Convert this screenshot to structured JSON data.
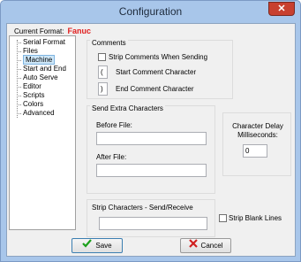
{
  "window": {
    "title": "Configuration"
  },
  "format": {
    "label": "Current Format:",
    "value": "Fanuc"
  },
  "tree": {
    "items": [
      {
        "label": "Serial Format",
        "selected": false
      },
      {
        "label": "Files",
        "selected": false
      },
      {
        "label": "Machine",
        "selected": true
      },
      {
        "label": "Start and End",
        "selected": false
      },
      {
        "label": "Auto Serve",
        "selected": false
      },
      {
        "label": "Editor",
        "selected": false
      },
      {
        "label": "Scripts",
        "selected": false
      },
      {
        "label": "Colors",
        "selected": false
      },
      {
        "label": "Advanced",
        "selected": false
      }
    ]
  },
  "comments": {
    "title": "Comments",
    "strip_label": "Strip Comments When Sending",
    "start_value": "(",
    "start_label": "Start Comment Character",
    "end_value": ")",
    "end_label": "End Comment Character"
  },
  "extra": {
    "title": "Send Extra Characters",
    "before_label": "Before File:",
    "before_value": "",
    "after_label": "After File:",
    "after_value": ""
  },
  "delay": {
    "label_line1": "Character Delay",
    "label_line2": "Milliseconds:",
    "value": "0"
  },
  "strip": {
    "title": "Strip Characters - Send/Receive",
    "value": "",
    "blank_lines_label": "Strip Blank Lines"
  },
  "buttons": {
    "save": "Save",
    "cancel": "Cancel"
  },
  "colors": {
    "save_check": "#1aa01a",
    "cancel_x": "#d02020",
    "accent_red": "#e02020"
  }
}
